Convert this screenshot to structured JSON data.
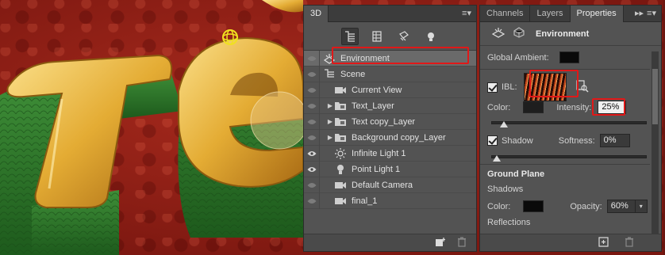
{
  "panel3d": {
    "tab": "3D",
    "menu_glyph": "≡▾",
    "toolbar": [
      "whole-scene-icon",
      "meshes-icon",
      "materials-icon",
      "lights-icon"
    ],
    "rows": [
      {
        "label": "Environment",
        "icon": "environment-icon",
        "eye": false,
        "twisty": false,
        "indent": 0,
        "selected": true
      },
      {
        "label": "Scene",
        "icon": "scene-icon",
        "eye": false,
        "twisty": false,
        "indent": 0,
        "selected": false
      },
      {
        "label": "Current View",
        "icon": "camera-icon",
        "eye": false,
        "twisty": false,
        "indent": 1,
        "selected": false
      },
      {
        "label": "Text_Layer",
        "icon": "folder-mesh-icon",
        "eye": false,
        "twisty": true,
        "indent": 1,
        "selected": false
      },
      {
        "label": "Text copy_Layer",
        "icon": "folder-mesh-icon",
        "eye": false,
        "twisty": true,
        "indent": 1,
        "selected": false
      },
      {
        "label": "Background copy_Layer",
        "icon": "folder-mesh-icon",
        "eye": false,
        "twisty": true,
        "indent": 1,
        "selected": false
      },
      {
        "label": "Infinite Light 1",
        "icon": "infinite-light-icon",
        "eye": true,
        "twisty": false,
        "indent": 1,
        "selected": false
      },
      {
        "label": "Point Light 1",
        "icon": "point-light-icon",
        "eye": true,
        "twisty": false,
        "indent": 1,
        "selected": false
      },
      {
        "label": "Default Camera",
        "icon": "camera-icon",
        "eye": false,
        "twisty": false,
        "indent": 1,
        "selected": false
      },
      {
        "label": "final_1",
        "icon": "camera-icon",
        "eye": false,
        "twisty": false,
        "indent": 1,
        "selected": false
      }
    ],
    "footer_icons": [
      "add-light-icon",
      "trash-icon"
    ]
  },
  "props": {
    "tabs": [
      "Channels",
      "Layers",
      "Properties"
    ],
    "active_tab": "Properties",
    "collapse_glyph": "▸▸",
    "menu_glyph": "≡▾",
    "title": "Environment",
    "global_ambient_label": "Global Ambient:",
    "ibl_label": "IBL:",
    "color_label": "Color:",
    "intensity_label": "Intensity:",
    "intensity_value": "25%",
    "intensity_level": 0.25,
    "shadow_label": "Shadow",
    "softness_label": "Softness:",
    "softness_value": "0%",
    "softness_level": 0.0,
    "ground_plane_label": "Ground Plane",
    "shadows_label": "Shadows",
    "gp_color_label": "Color:",
    "opacity_label": "Opacity:",
    "opacity_value": "60%",
    "reflections_label": "Reflections",
    "footer_icons": [
      "render-icon",
      "trash-icon"
    ]
  },
  "colors": {
    "panel": "#535353",
    "highlight_red": "#e01818",
    "gold": "#e8b53c",
    "green": "#2f7a2c"
  }
}
